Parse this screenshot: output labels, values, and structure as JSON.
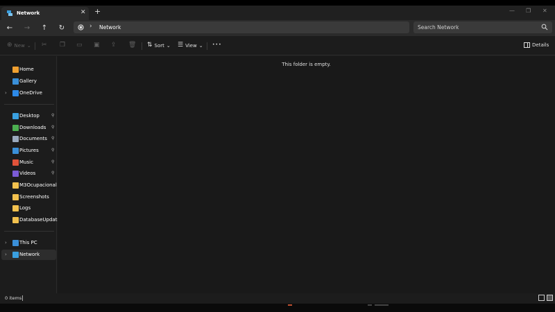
{
  "tab": {
    "title": "Network",
    "close_glyph": "✕",
    "new_tab_glyph": "+"
  },
  "window_controls": {
    "minimize": "—",
    "maximize": "❐",
    "close": "✕"
  },
  "nav": {
    "back_glyph": "←",
    "forward_glyph": "→",
    "up_glyph": "↑",
    "refresh_glyph": "↻",
    "breadcrumb_separator": "›",
    "address_text": "Network",
    "search_placeholder": "Search Network"
  },
  "toolbar": {
    "new_label": "New",
    "sort_label": "Sort",
    "view_label": "View",
    "more_glyph": "•••",
    "details_label": "Details",
    "dropdown_glyph": "⌄"
  },
  "sidebar": {
    "items": [
      {
        "label": "Home",
        "icon": "home-icon",
        "color": "#f0a030"
      },
      {
        "label": "Gallery",
        "icon": "gallery-icon",
        "color": "#3a8fd8"
      },
      {
        "label": "OneDrive",
        "icon": "cloud-icon",
        "color": "#2d8ae8",
        "expandable": true
      },
      {
        "label": "Desktop",
        "icon": "desktop-icon",
        "color": "#3aa0e0",
        "pinned": true
      },
      {
        "label": "Downloads",
        "icon": "download-icon",
        "color": "#4caf50",
        "pinned": true
      },
      {
        "label": "Documents",
        "icon": "document-icon",
        "color": "#9aa9bd",
        "pinned": true
      },
      {
        "label": "Pictures",
        "icon": "pictures-icon",
        "color": "#3a8fd8",
        "pinned": true
      },
      {
        "label": "Music",
        "icon": "music-icon",
        "color": "#e0533a",
        "pinned": true
      },
      {
        "label": "Videos",
        "icon": "video-icon",
        "color": "#7b5bd6",
        "pinned": true
      },
      {
        "label": "M3Ocupacional",
        "icon": "folder-icon",
        "color": "#f2c14e"
      },
      {
        "label": "Screenshots",
        "icon": "folder-icon",
        "color": "#f2c14e"
      },
      {
        "label": "Logs",
        "icon": "folder-icon",
        "color": "#f2c14e"
      },
      {
        "label": "DatabaseUpdate",
        "icon": "folder-icon",
        "color": "#f2c14e"
      },
      {
        "label": "This PC",
        "icon": "pc-icon",
        "color": "#3a8fd8",
        "expandable": true
      },
      {
        "label": "Network",
        "icon": "network-icon",
        "color": "#3aa0e0",
        "expandable": true,
        "selected": true
      }
    ],
    "expand_glyph": "›",
    "pin_glyph": "📌"
  },
  "content": {
    "empty_message": "This folder is empty."
  },
  "status": {
    "item_count": "0 items"
  },
  "colors": {
    "accent": "#3aa0e0",
    "background": "#1c1c1c"
  }
}
